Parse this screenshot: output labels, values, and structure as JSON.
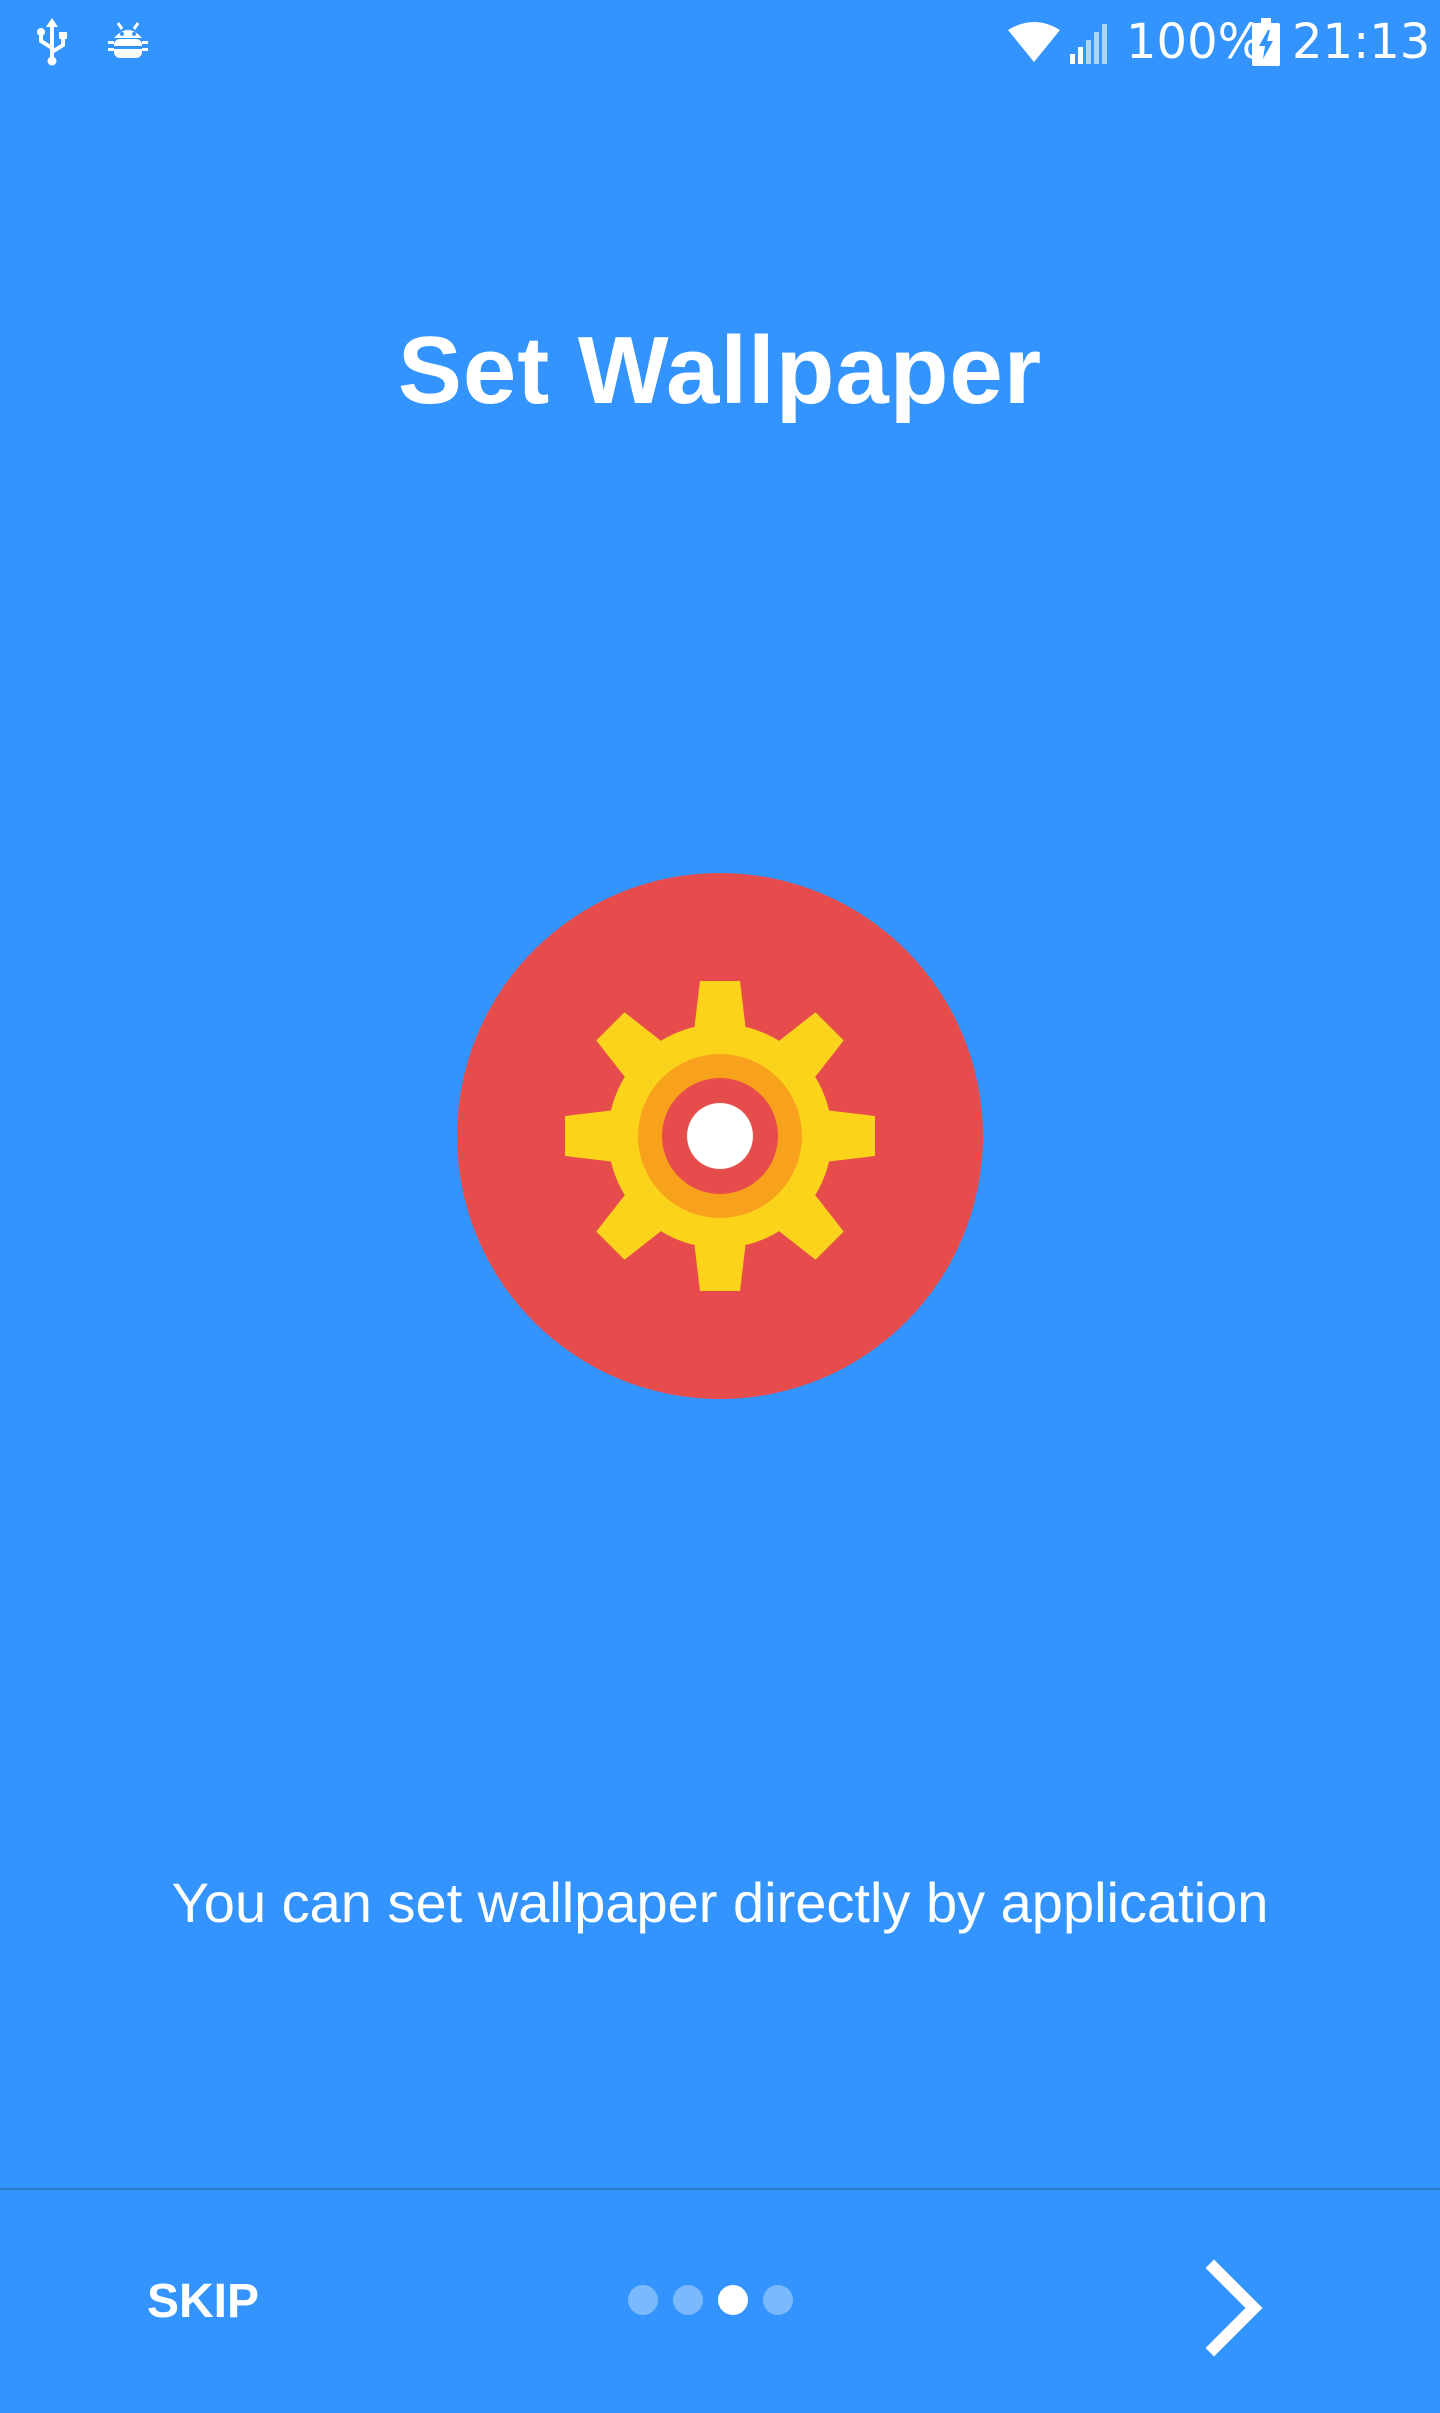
{
  "status_bar": {
    "battery_percent": "100%",
    "time": "21:13",
    "icons": [
      "usb-icon",
      "android-debug-icon",
      "wifi-icon",
      "cellular-signal-icon",
      "battery-charging-icon"
    ]
  },
  "onboarding": {
    "title": "Set Wallpaper",
    "description": "You can set wallpaper directly by application",
    "hero_icon": "settings-gear-icon",
    "colors": {
      "background": "#3494fe",
      "hero_circle": "#e64c4c",
      "gear": "#fbd31a",
      "gear_ring": "#f8a11a"
    }
  },
  "footer": {
    "skip_label": "SKIP",
    "page_indicator": {
      "total": 4,
      "current": 3
    },
    "next_icon": "chevron-right-icon"
  }
}
